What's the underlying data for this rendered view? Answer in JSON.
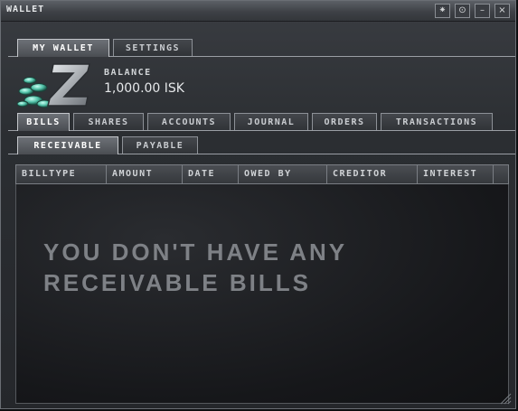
{
  "window": {
    "title": "WALLET",
    "buttons": [
      {
        "icon": "pin-icon",
        "glyph": "⁕"
      },
      {
        "icon": "minimize-circle-icon",
        "glyph": "⊙"
      },
      {
        "icon": "minimize-icon",
        "glyph": "–"
      },
      {
        "icon": "close-icon",
        "glyph": "×"
      }
    ]
  },
  "main_tabs": [
    "MY WALLET",
    "SETTINGS"
  ],
  "balance": {
    "label": "BALANCE",
    "value": "1,000.00 ISK"
  },
  "section_tabs": [
    "BILLS",
    "SHARES",
    "ACCOUNTS",
    "JOURNAL",
    "ORDERS",
    "TRANSACTIONS"
  ],
  "sub_tabs": [
    "RECEIVABLE",
    "PAYABLE"
  ],
  "table": {
    "columns": [
      "BILLTYPE",
      "AMOUNT",
      "DATE",
      "OWED BY",
      "CREDITOR",
      "INTEREST"
    ],
    "empty_message": "YOU DON'T HAVE ANY RECEIVABLE BILLS"
  },
  "colors": {
    "frame": "#2b2e32",
    "active_tab": "#6d7177",
    "empty_text": "#7e8186"
  }
}
